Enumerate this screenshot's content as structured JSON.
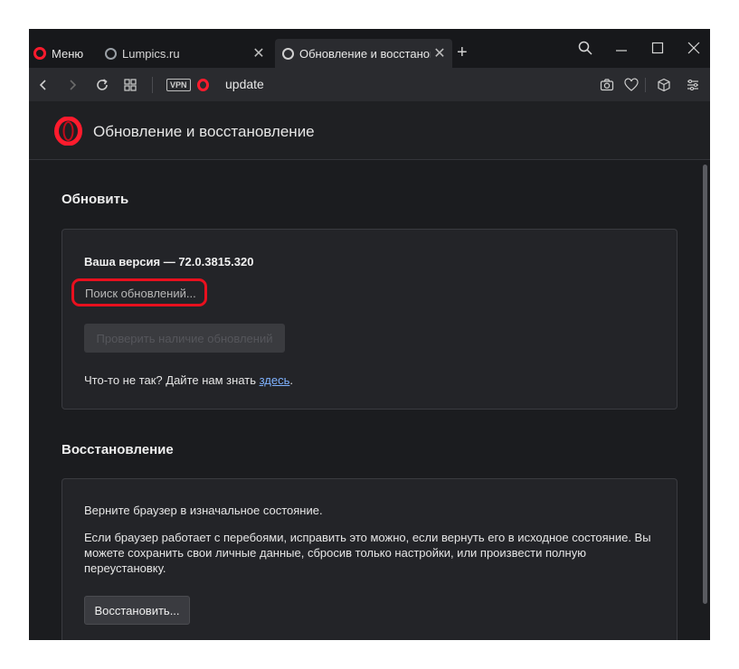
{
  "browser": {
    "menu_label": "Меню",
    "tabs": [
      {
        "title": "Lumpics.ru",
        "active": false
      },
      {
        "title": "Обновление и восстановл",
        "active": true
      }
    ],
    "address": "update",
    "vpn_label": "VPN"
  },
  "page": {
    "title": "Обновление и восстановление",
    "update_section": {
      "heading": "Обновить",
      "version_text": "Ваша версия — 72.0.3815.320",
      "status_text": "Поиск обновлений...",
      "check_button_label": "Проверить наличие обновлений",
      "feedback_prefix": "Что-то не так? Дайте нам знать ",
      "feedback_link": "здесь",
      "feedback_suffix": "."
    },
    "restore_section": {
      "heading": "Восстановление",
      "line1": "Верните браузер в изначальное состояние.",
      "description": "Если браузер работает с перебоями, исправить это можно, если вернуть его в исходное состояние. Вы можете сохранить свои личные данные, сбросив только настройки, или произвести полную переустановку.",
      "button_label": "Восстановить..."
    }
  },
  "colors": {
    "brand": "#ff1b2d",
    "highlight": "#e8101e",
    "background": "#1b1c1f",
    "card": "#232428",
    "link": "#7fb2ff"
  }
}
